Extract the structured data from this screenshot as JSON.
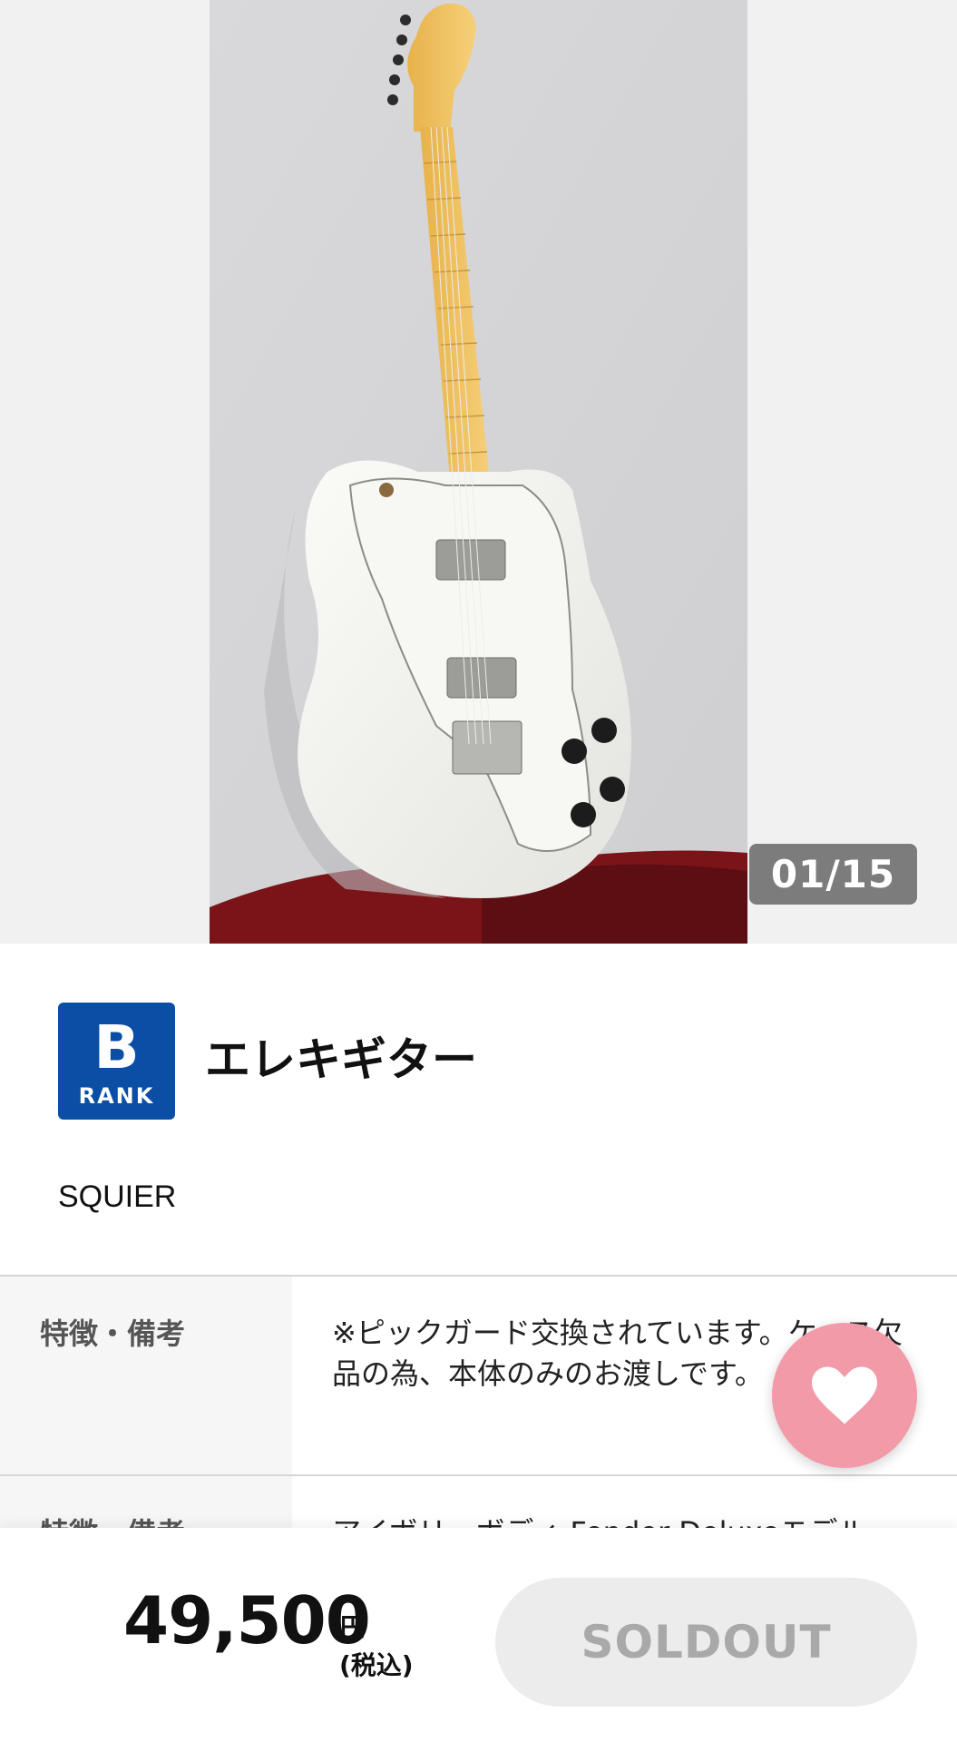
{
  "gallery": {
    "counter": "01/15",
    "image_alt": "white electric guitar"
  },
  "product": {
    "rank_letter": "B",
    "rank_word": "RANK",
    "title": "エレキギター",
    "brand": "SQUIER"
  },
  "specs": [
    {
      "label": "特徴・備考",
      "value": "※ピックガード交換されています。ケース欠品の為、本体のみのお渡しです。"
    },
    {
      "label": "特徴・備考",
      "value": "アイボリーボディ Fender Deluxeモデル"
    }
  ],
  "favorite": {
    "icon": "heart-icon"
  },
  "purchase": {
    "price": "49,500",
    "currency": "円",
    "tax_note": "(税込)",
    "button_label": "SOLDOUT"
  },
  "colors": {
    "rank_blue": "#0a4ea6",
    "favorite_pink": "#f29aa8",
    "counter_gray": "#7c7c7c",
    "soldout_bg": "#ececec"
  }
}
